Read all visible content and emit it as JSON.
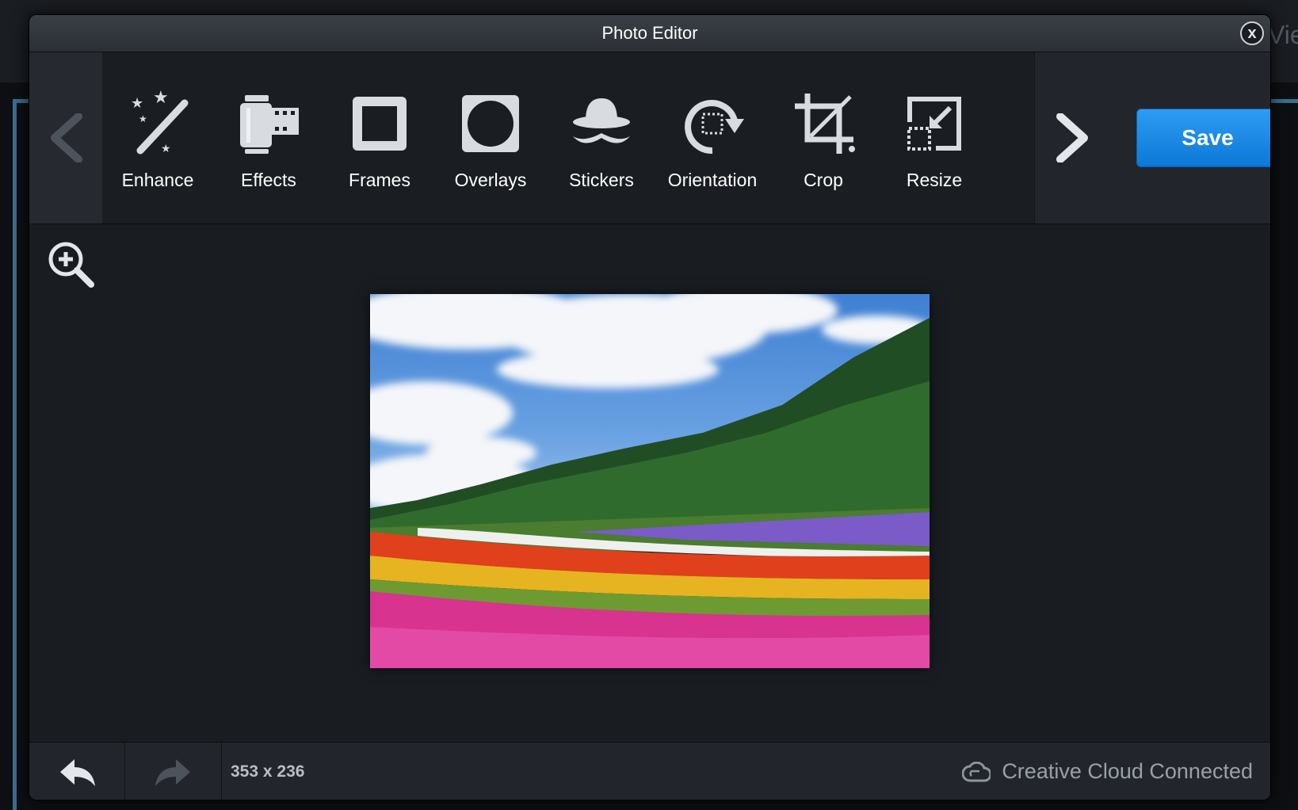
{
  "window": {
    "title": "Photo Editor",
    "close_label": "x"
  },
  "background": {
    "peek_text": "Vie"
  },
  "toolbar": {
    "tools": [
      {
        "label": "Enhance",
        "icon": "magic-wand-icon"
      },
      {
        "label": "Effects",
        "icon": "film-canister-icon"
      },
      {
        "label": "Frames",
        "icon": "frame-icon"
      },
      {
        "label": "Overlays",
        "icon": "overlay-circle-icon"
      },
      {
        "label": "Stickers",
        "icon": "hat-mustache-icon"
      },
      {
        "label": "Orientation",
        "icon": "rotate-icon"
      },
      {
        "label": "Crop",
        "icon": "crop-icon"
      },
      {
        "label": "Resize",
        "icon": "resize-icon"
      }
    ],
    "save_label": "Save",
    "accent_color": "#1a8ae6"
  },
  "canvas": {
    "zoom_icon": "zoom-in-icon",
    "photo_alt": "Flower field with pine trees and cloudy sky"
  },
  "footer": {
    "image_dimensions": "353 x 236",
    "cloud_status": "Creative Cloud Connected",
    "cloud_icon": "creative-cloud-icon"
  }
}
